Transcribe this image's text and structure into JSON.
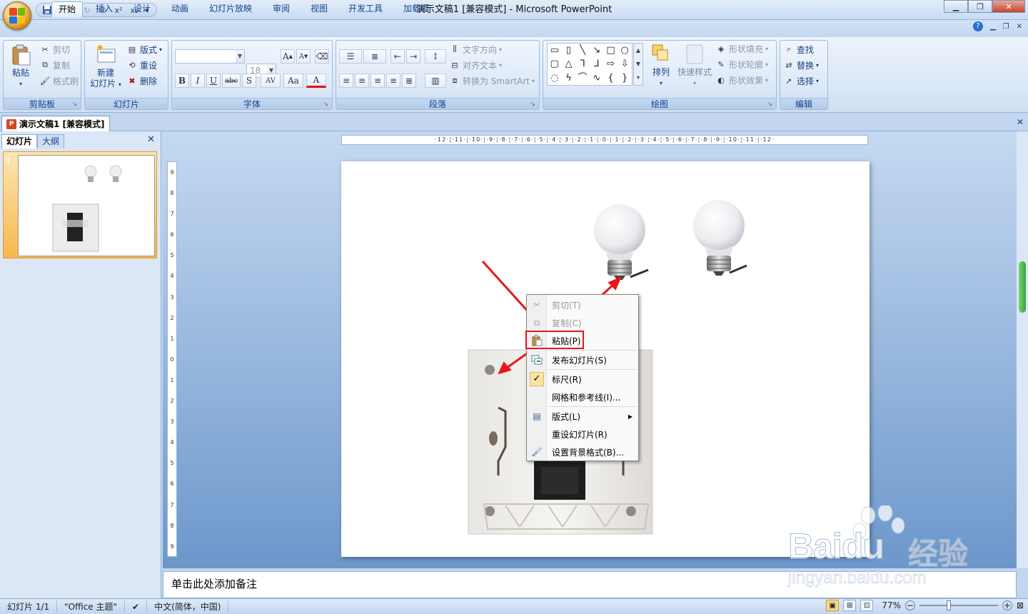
{
  "window": {
    "title": "演示文稿1 [兼容模式] - Microsoft PowerPoint"
  },
  "qat": {
    "superscript": "x²",
    "subscript": "x₂",
    "customize": "▾"
  },
  "ribbon_tabs": [
    {
      "label": "开始",
      "active": true
    },
    {
      "label": "插入"
    },
    {
      "label": "设计"
    },
    {
      "label": "动画"
    },
    {
      "label": "幻灯片放映"
    },
    {
      "label": "审阅"
    },
    {
      "label": "视图"
    },
    {
      "label": "开发工具"
    },
    {
      "label": "加载项"
    }
  ],
  "ribbon": {
    "clipboard": {
      "label": "剪贴板",
      "paste": "粘贴",
      "cut": "剪切",
      "copy": "复制",
      "format_painter": "格式刷"
    },
    "slides": {
      "label": "幻灯片",
      "new_slide_line1": "新建",
      "new_slide_line2": "幻灯片",
      "layout": "版式",
      "reset": "重设",
      "delete": "删除"
    },
    "font": {
      "label": "字体",
      "font_name": "",
      "font_size": "18",
      "grow": "A",
      "shrink": "A",
      "bold": "B",
      "italic": "I",
      "underline": "U",
      "strike": "abc",
      "shadow": "S",
      "spacing": "AV",
      "case": "Aa",
      "color": "A"
    },
    "paragraph": {
      "label": "段落",
      "text_direction": "文字方向",
      "align_text": "对齐文本",
      "smartart": "转换为 SmartArt"
    },
    "drawing": {
      "label": "绘图",
      "arrange": "排列",
      "quick_styles": "快速样式",
      "shape_fill": "形状填充",
      "shape_outline": "形状轮廓",
      "shape_effects": "形状效果"
    },
    "editing": {
      "label": "编辑",
      "find": "查找",
      "replace": "替换",
      "select": "选择"
    }
  },
  "doc_tab": {
    "title": "演示文稿1 [兼容模式]"
  },
  "left_pane": {
    "tab_slides": "幻灯片",
    "tab_outline": "大纲",
    "slide_number": "1"
  },
  "hruler_text": "·12·¦·11·¦·10·¦·9·¦·8·¦·7·¦·6·¦·5·¦·4·¦·3·¦·2·¦·1·¦·0·¦·1·¦·2·¦·3·¦·4·¦·5·¦·6·¦·7·¦·8·¦·9·¦·10·¦·11·¦·12·",
  "vruler_marks": [
    "9",
    "8",
    "7",
    "6",
    "5",
    "4",
    "3",
    "2",
    "1",
    "0",
    "1",
    "2",
    "3",
    "4",
    "5",
    "6",
    "7",
    "8",
    "9"
  ],
  "context_menu": {
    "items": [
      {
        "label": "剪切(T)",
        "icon": "scissors-icon",
        "disabled": true
      },
      {
        "label": "复制(C)",
        "icon": "copy-icon",
        "disabled": true
      },
      {
        "label": "粘贴(P)",
        "icon": "paste-icon",
        "highlighted": true
      },
      {
        "label": "发布幻灯片(S)",
        "icon": "publish-icon"
      },
      {
        "label": "标尺(R)",
        "icon": "checkmark-icon",
        "checked": true
      },
      {
        "label": "网格和参考线(I)...",
        "icon": ""
      },
      {
        "label": "版式(L)",
        "icon": "layout-icon",
        "submenu": true
      },
      {
        "label": "重设幻灯片(R)",
        "icon": ""
      },
      {
        "label": "设置背景格式(B)...",
        "icon": "background-format-icon"
      }
    ]
  },
  "notes": {
    "placeholder": "单击此处添加备注"
  },
  "status": {
    "slide": "幻灯片 1/1",
    "theme": "\"Office 主题\"",
    "language": "中文(简体，中国)",
    "zoom": "77%",
    "zoom_value": 0.77
  },
  "watermark": {
    "brand": "Bai",
    "brand2": "du",
    "product": "经验",
    "url": "jingyan.baidu.com"
  },
  "colors": {
    "annotation_red": "#e8161b",
    "ribbon_text": "#15428b",
    "highlight": "#f9d98a"
  }
}
